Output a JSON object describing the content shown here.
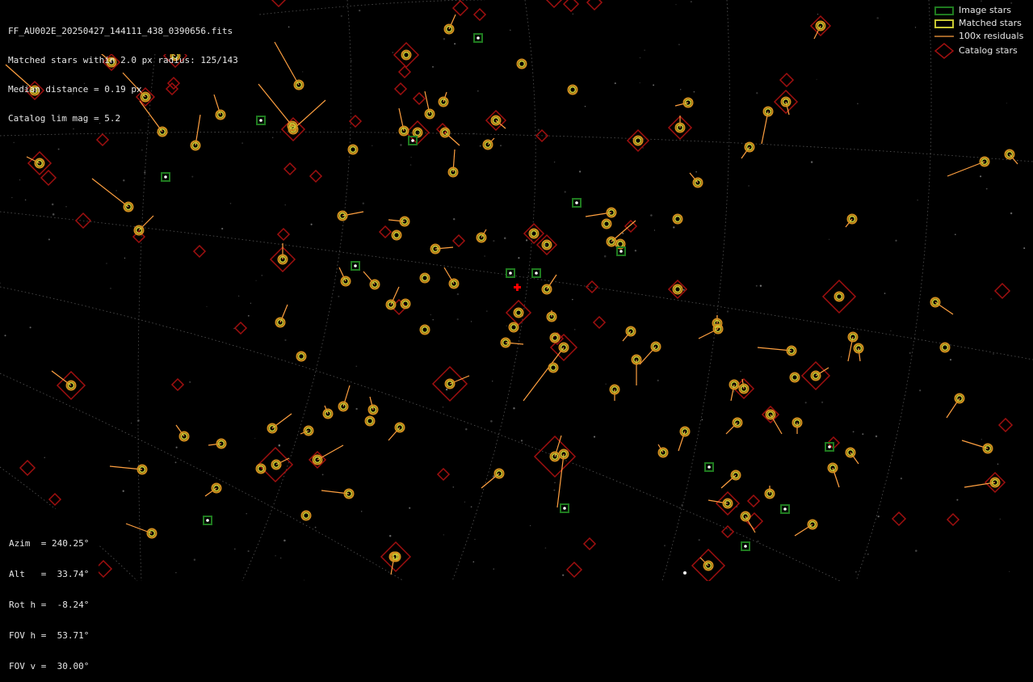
{
  "header_info": {
    "filename": "FF_AU002E_20250427_144111_438_0390656.fits",
    "matched": "Matched stars within 2.0 px radius: 125/143",
    "median": "Median distance = 0.19 px",
    "catalog": "Catalog lim mag = 5.2"
  },
  "pose_info": {
    "azim": "Azim  = 240.25°",
    "alt": "Alt   =  33.74°",
    "rot": "Rot h =  -8.24°",
    "fov_h": "FOV h =  53.71°",
    "fov_v": "FOV v =  30.00°"
  },
  "legend": {
    "image_stars": "Image stars",
    "matched_stars": "Matched stars",
    "residuals": "100x residuals",
    "catalog_stars": "Catalog stars"
  },
  "colors": {
    "background": "#000000",
    "image_star": "#1f7a1f",
    "matched_star": "#c8c832",
    "residual": "#ffa040",
    "catalog_star": "#a01010",
    "center_marker": "#ff0000",
    "grid": "#555555"
  }
}
